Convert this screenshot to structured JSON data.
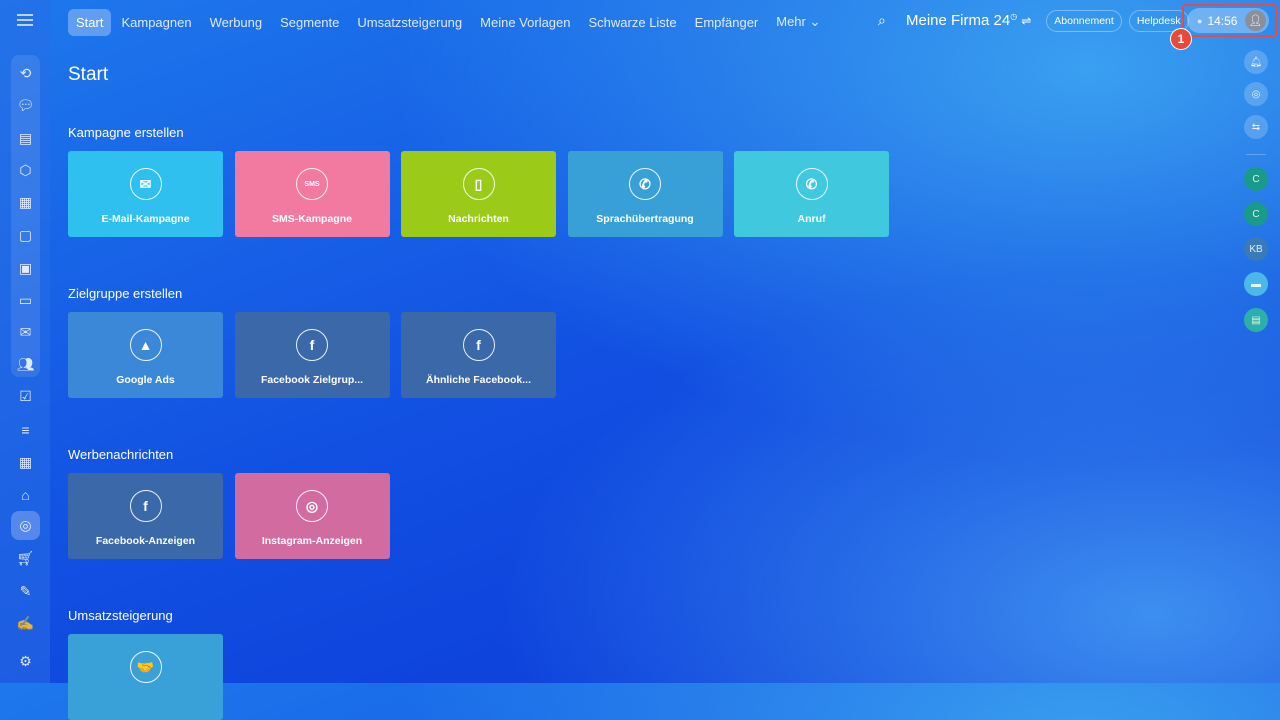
{
  "nav": {
    "tabs": [
      "Start",
      "Kampagnen",
      "Werbung",
      "Segmente",
      "Umsatzsteigerung",
      "Meine Vorlagen",
      "Schwarze Liste",
      "Empfänger",
      "Mehr ⌄"
    ]
  },
  "header": {
    "company": "Meine Firma",
    "company_suffix": "24",
    "subscription": "Abonnement",
    "helpdesk": "Helpdesk",
    "time": "14:56",
    "annotation": "1"
  },
  "right_sidebar": {
    "avatars": [
      "C",
      "C",
      "KB"
    ]
  },
  "page": {
    "title": "Start"
  },
  "sections": [
    {
      "title": "Kampagne erstellen",
      "cards": [
        {
          "label": "E-Mail-Kampagne",
          "icon": "✉",
          "color": "#2fc0ef"
        },
        {
          "label": "SMS-Kampagne",
          "icon": "SMS",
          "color": "#f27aa0"
        },
        {
          "label": "Nachrichten",
          "icon": "▯",
          "color": "#9bcb18"
        },
        {
          "label": "Sprachübertragung",
          "icon": "✆",
          "color": "#38a0d6"
        },
        {
          "label": "Anruf",
          "icon": "✆",
          "color": "#40c8de"
        }
      ]
    },
    {
      "title": "Zielgruppe erstellen",
      "cards": [
        {
          "label": "Google Ads",
          "icon": "▲",
          "color": "#3c88d8"
        },
        {
          "label": "Facebook Zielgrup...",
          "icon": "f",
          "color": "#3a68a8"
        },
        {
          "label": "Ähnliche Facebook...",
          "icon": "f",
          "color": "#3a68a8"
        }
      ]
    },
    {
      "title": "Werbenachrichten",
      "cards": [
        {
          "label": "Facebook-Anzeigen",
          "icon": "f",
          "color": "#3a68a8"
        },
        {
          "label": "Instagram-Anzeigen",
          "icon": "◎",
          "color": "#d26ca0"
        }
      ]
    },
    {
      "title": "Umsatzsteigerung",
      "cards": [
        {
          "label": "",
          "icon": "🤝",
          "color": "#3aa0d8"
        }
      ]
    }
  ]
}
